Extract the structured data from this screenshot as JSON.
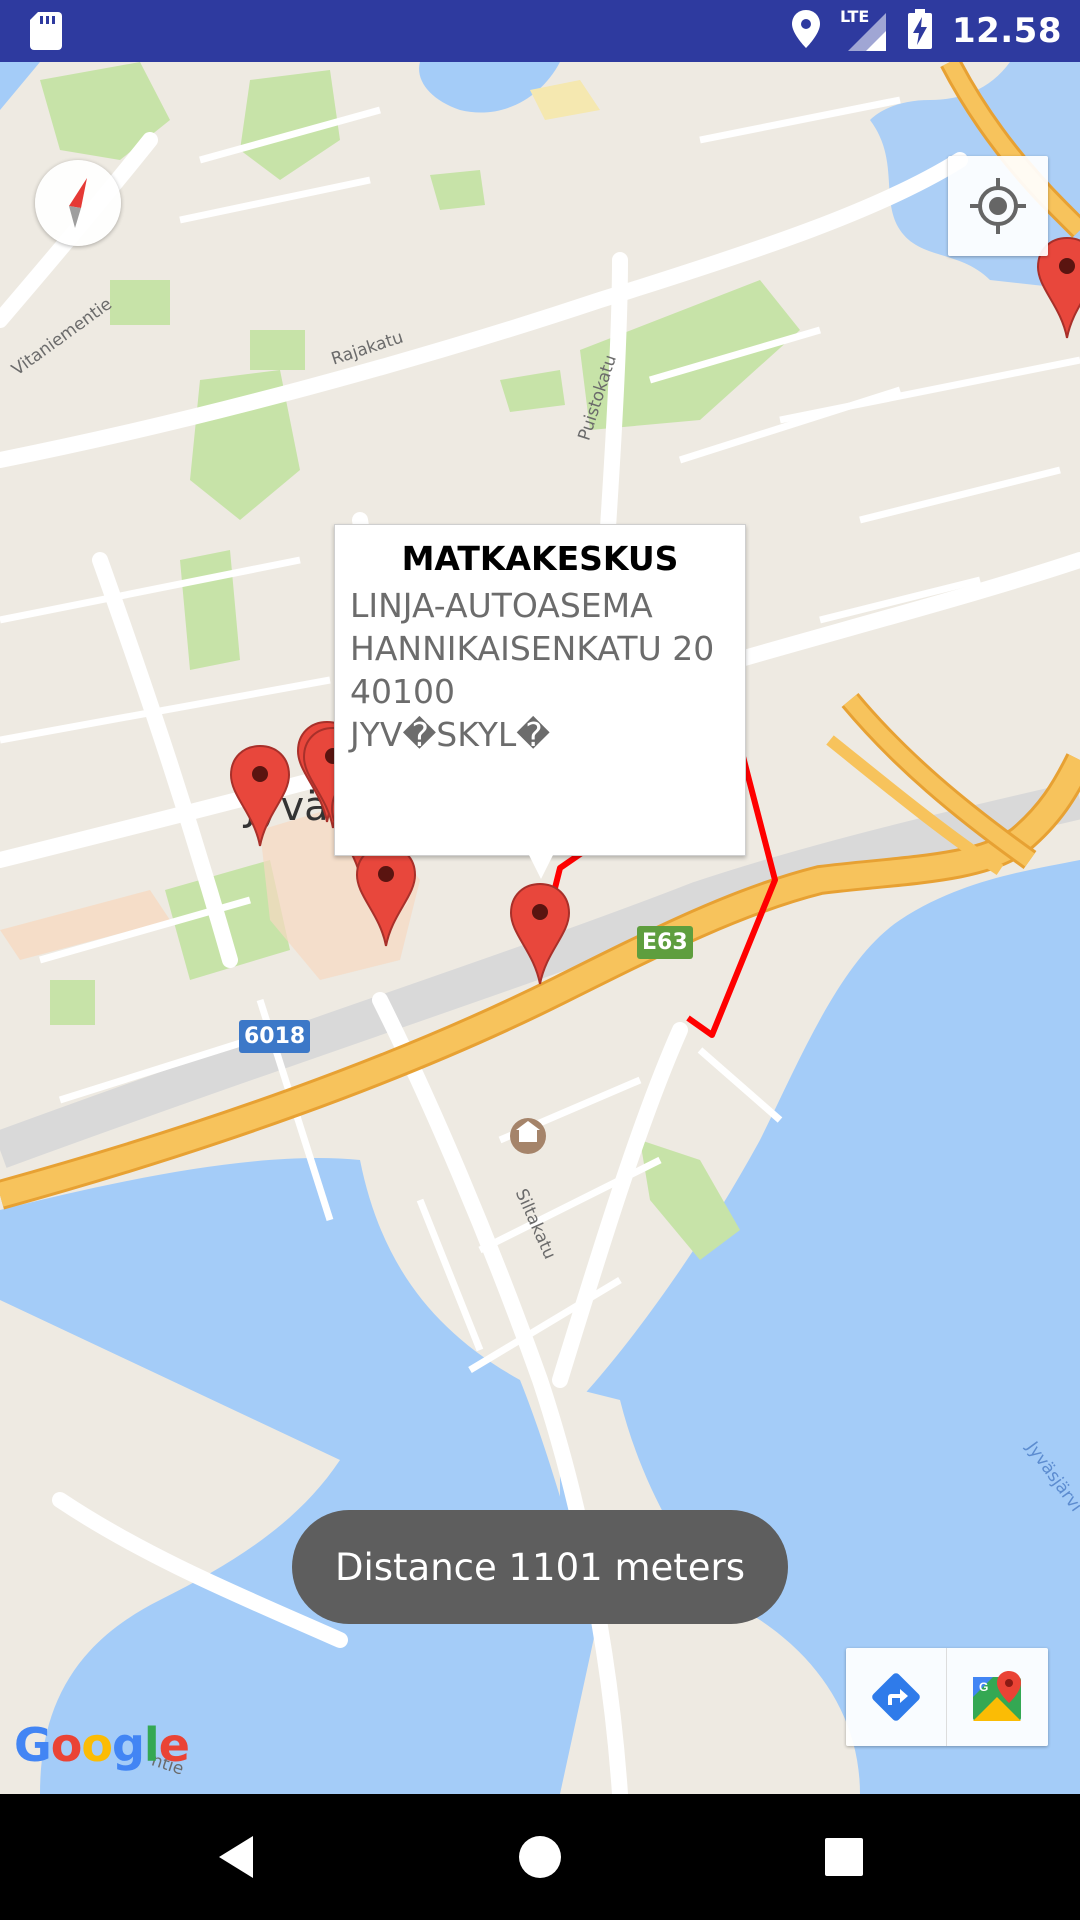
{
  "status_bar": {
    "time": "12.58",
    "network": "LTE",
    "icons": [
      "sd-card-icon",
      "location-icon",
      "signal-icon",
      "battery-charging-icon"
    ]
  },
  "map": {
    "street_labels": [
      "Vitaniementie",
      "Rajakatu",
      "Puistokatu",
      "Siltakatu",
      "Jyväsjärvi",
      "ntie"
    ],
    "city_label": "Jyväskylä",
    "road_shields": [
      {
        "text": "6018",
        "color": "#3C78C8"
      },
      {
        "text": "E63",
        "color": "#5E9E3E"
      }
    ],
    "route_color": "#FF0000",
    "marker_color": "#E8473C",
    "water_color": "#A4CCF8",
    "land_color": "#EEEAE2",
    "park_color": "#C7E3A8",
    "highway_color": "#F7C35C"
  },
  "info_window": {
    "title": "MATKAKESKUS",
    "lines": [
      "LINJA-AUTOASEMA",
      "HANNIKAISENKATU 20",
      "40100",
      "JYV�SKYL�"
    ]
  },
  "toast": {
    "message": "Distance 1101 meters"
  },
  "attribution": {
    "logo": "Google"
  },
  "map_toolbar": {
    "icons": [
      "directions-icon",
      "google-maps-icon"
    ]
  },
  "nav_bar": {
    "icons": [
      "back-icon",
      "home-icon",
      "recents-icon"
    ]
  },
  "controls": {
    "compass_icon": "compass-icon",
    "my_location_icon": "my-location-icon"
  }
}
